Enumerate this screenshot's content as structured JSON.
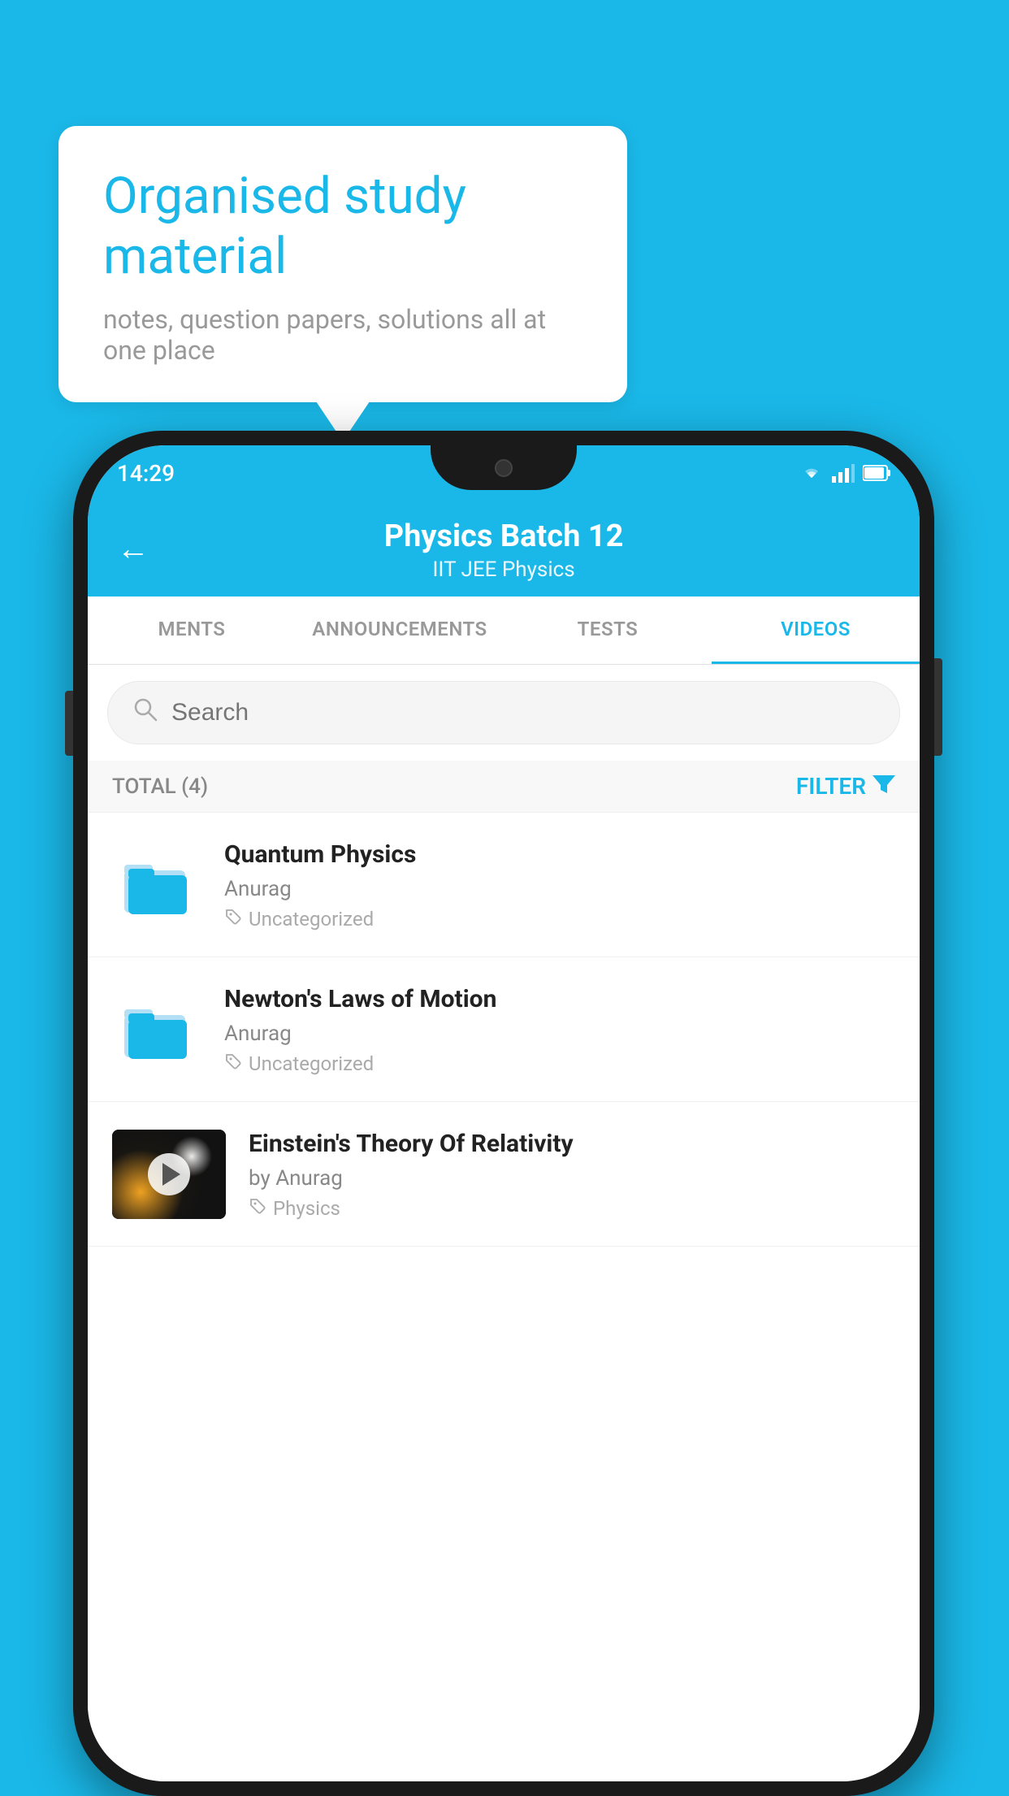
{
  "background_color": "#1ab8e8",
  "speech_bubble": {
    "title": "Organised study material",
    "subtitle": "notes, question papers, solutions all at one place"
  },
  "phone": {
    "status_bar": {
      "time": "14:29",
      "icons": [
        "wifi",
        "signal",
        "battery"
      ]
    },
    "header": {
      "back_label": "←",
      "title": "Physics Batch 12",
      "subtitle": "IIT JEE   Physics"
    },
    "tabs": [
      {
        "label": "MENTS",
        "active": false
      },
      {
        "label": "ANNOUNCEMENTS",
        "active": false
      },
      {
        "label": "TESTS",
        "active": false
      },
      {
        "label": "VIDEOS",
        "active": true
      }
    ],
    "search": {
      "placeholder": "Search"
    },
    "filter_bar": {
      "total_label": "TOTAL (4)",
      "filter_label": "FILTER"
    },
    "videos": [
      {
        "id": 1,
        "title": "Quantum Physics",
        "author": "Anurag",
        "tag": "Uncategorized",
        "type": "folder"
      },
      {
        "id": 2,
        "title": "Newton's Laws of Motion",
        "author": "Anurag",
        "tag": "Uncategorized",
        "type": "folder"
      },
      {
        "id": 3,
        "title": "Einstein's Theory Of Relativity",
        "author": "by Anurag",
        "tag": "Physics",
        "type": "video"
      }
    ]
  }
}
